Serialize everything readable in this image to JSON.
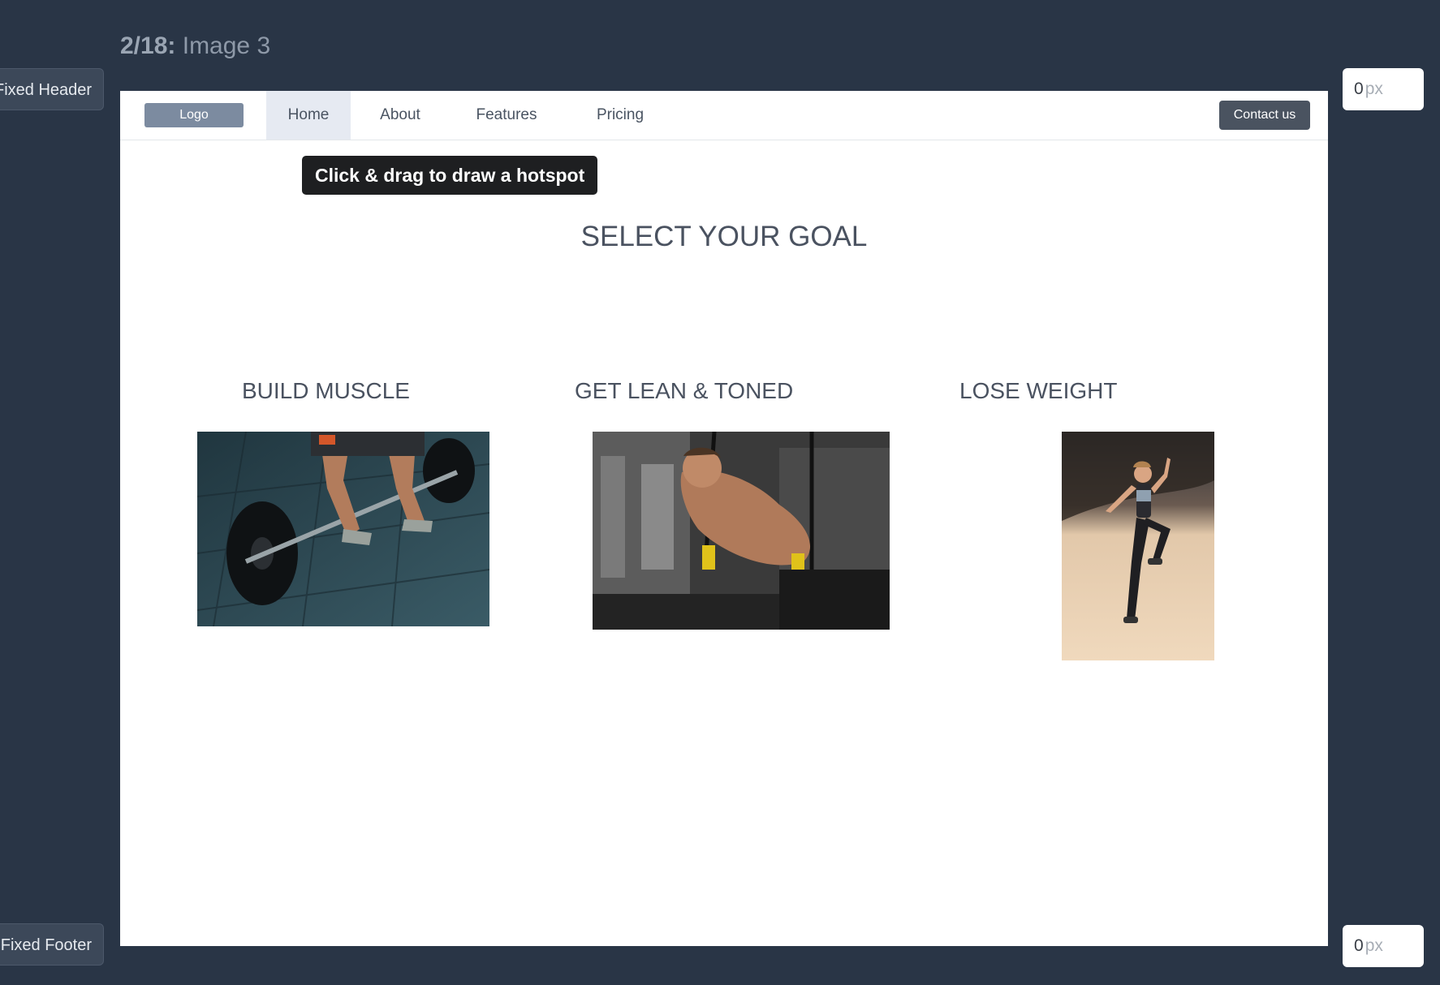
{
  "header": {
    "step": "2/18:",
    "name": "Image 3"
  },
  "side_tabs": {
    "header_label": "Fixed Header",
    "footer_label": "Fixed Footer"
  },
  "offsets": {
    "header_value": "0",
    "header_unit": "px",
    "footer_value": "0",
    "footer_unit": "px"
  },
  "nav": {
    "logo": "Logo",
    "items": [
      {
        "label": "Home",
        "active": true
      },
      {
        "label": "About"
      },
      {
        "label": "Features"
      },
      {
        "label": "Pricing"
      }
    ],
    "contact": "Contact us"
  },
  "tooltip": "Click & drag to draw a hotspot",
  "main": {
    "heading": "SELECT YOUR GOAL",
    "goals": [
      {
        "title": "BUILD MUSCLE",
        "image": "barbell-deadlift-photo"
      },
      {
        "title": "GET LEAN & TONED",
        "image": "suspension-trainer-photo"
      },
      {
        "title": "LOSE WEIGHT",
        "image": "beach-runner-photo"
      }
    ]
  },
  "colors": {
    "background": "#293546",
    "canvas": "#ffffff",
    "logo": "#7c8ba0",
    "contact": "#4a5360",
    "active_nav": "#e6eaf2",
    "tooltip": "#1e1f21"
  }
}
